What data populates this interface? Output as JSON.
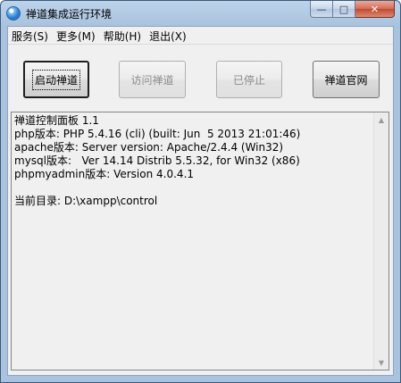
{
  "window": {
    "title": "禅道集成运行环境",
    "controls": {
      "minimize": "—",
      "maximize": "□",
      "close": "✕"
    }
  },
  "menu": [
    {
      "label": "服务(S)"
    },
    {
      "label": "更多(M)"
    },
    {
      "label": "帮助(H)"
    },
    {
      "label": "退出(X)"
    }
  ],
  "buttons": {
    "start": "启动禅道",
    "visit": "访问禅道",
    "stopped": "已停止",
    "official": "禅道官网"
  },
  "console": {
    "lines": [
      "禅道控制面板 1.1",
      "php版本: PHP 5.4.16 (cli) (built: Jun  5 2013 21:01:46)",
      "apache版本: Server version: Apache/2.4.4 (Win32)",
      "mysql版本:   Ver 14.14 Distrib 5.5.32, for Win32 (x86)",
      "phpmyadmin版本: Version 4.0.4.1",
      "",
      "当前目录: D:\\xampp\\control"
    ]
  },
  "icons": {
    "app": "globe-icon",
    "scroll_up": "chevron-up-icon",
    "scroll_down": "chevron-down-icon"
  }
}
